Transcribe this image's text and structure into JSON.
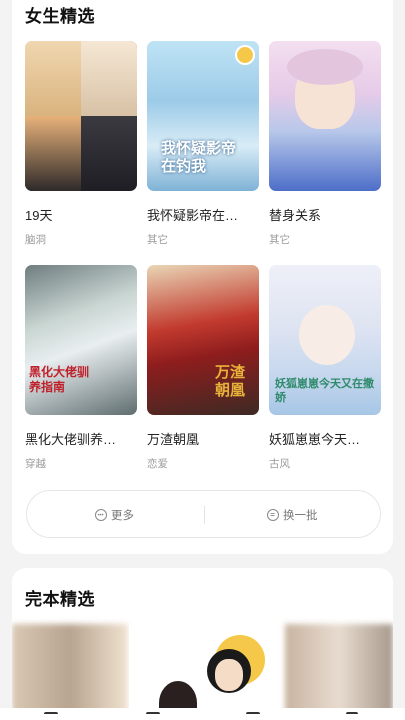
{
  "section1": {
    "title": "女生精选",
    "items": [
      {
        "name": "19天",
        "tag": "脑洞"
      },
      {
        "name": "我怀疑影帝在…",
        "tag": "其它",
        "cover_text": "我怀疑影帝在钓我"
      },
      {
        "name": "替身关系",
        "tag": "其它"
      },
      {
        "name": "黑化大佬驯养…",
        "tag": "穿越",
        "cover_text": "黑化大佬驯养指南"
      },
      {
        "name": "万渣朝凰",
        "tag": "恋爱",
        "cover_text": "万渣朝凰"
      },
      {
        "name": "妖狐崽崽今天…",
        "tag": "古风",
        "cover_text": "妖狐崽崽今天又在撒娇"
      }
    ],
    "more_label": "更多",
    "refresh_label": "换一批"
  },
  "section2": {
    "title": "完本精选"
  },
  "colors": {
    "accent_badge": "#f6c84a",
    "text_primary": "#222222",
    "text_secondary": "#9a9a9a"
  },
  "icons": [
    "more-icon",
    "refresh-icon",
    "badge-icon"
  ]
}
